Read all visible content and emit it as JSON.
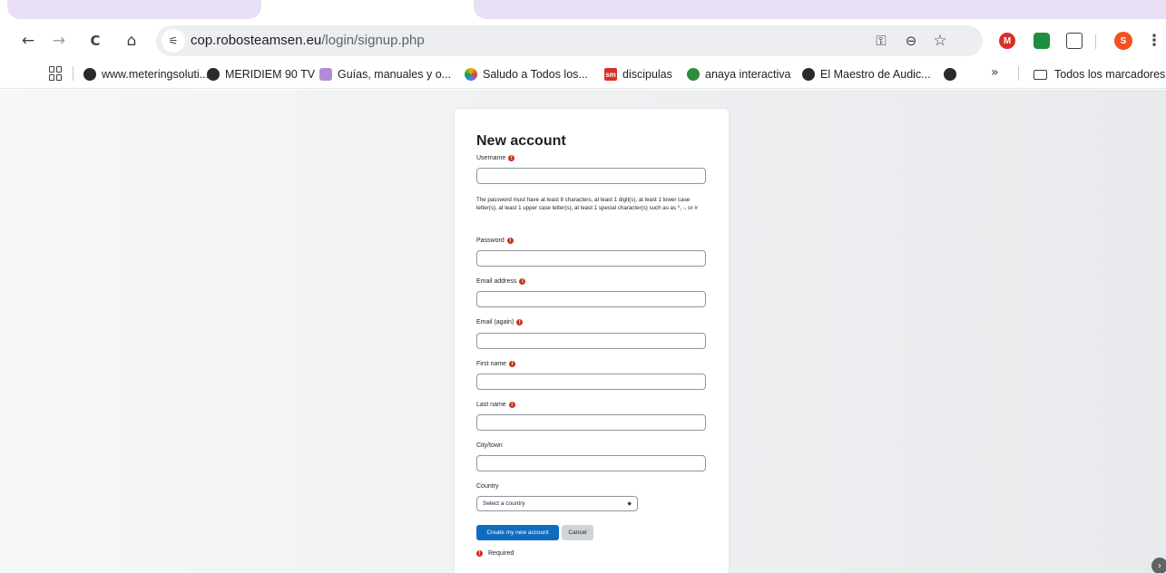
{
  "browser": {
    "url_host": "cop.robosteamsen.eu",
    "url_path": "/login/signup.php",
    "nav": {
      "back": "←",
      "forward": "→",
      "reload": "C",
      "home": "⌂",
      "site_info": "⚟"
    },
    "omnibox_icons": {
      "key": "⚿",
      "zoom": "⊖",
      "star": "☆"
    },
    "extensions": {
      "m_label": "M",
      "profile_initial": "S",
      "menu": "⋮"
    },
    "colors": {
      "tab_strip": "#e9dff6",
      "extension_red": "#d93025",
      "extension_green": "#1e8e3e",
      "profile_orange": "#f4511e"
    }
  },
  "bookmarks": {
    "items": [
      {
        "label": "www.meteringsoluti...",
        "icon": "globe-icon"
      },
      {
        "label": "MERIDIEM 90 TV",
        "icon": "globe-icon"
      },
      {
        "label": "Guías, manuales y o...",
        "icon": "sparkle-icon"
      },
      {
        "label": "Saludo a Todos los...",
        "icon": "colorful-ball-icon"
      },
      {
        "label": "discipulas",
        "icon": "sm-icon"
      },
      {
        "label": "anaya interactiva",
        "icon": "green-circle-icon"
      },
      {
        "label": "El Maestro de Audic...",
        "icon": "globe-icon"
      }
    ],
    "more": "»",
    "all_bookmarks": "Todos los marcadores",
    "sm_badge": "sm"
  },
  "form": {
    "title": "New account",
    "password_hint": "The password must have at least 8 characters, at least 1 digit(s), at least 1 lower case letter(s), at least 1 upper case letter(s), at least 1 special character(s) such as as *, -, or #",
    "fields": {
      "username": {
        "label": "Username",
        "value": ""
      },
      "password": {
        "label": "Password",
        "value": ""
      },
      "email": {
        "label": "Email address",
        "value": ""
      },
      "email_again": {
        "label": "Email (again)",
        "value": ""
      },
      "first_name": {
        "label": "First name",
        "value": ""
      },
      "last_name": {
        "label": "Last name",
        "value": ""
      },
      "city": {
        "label": "City/town",
        "value": ""
      },
      "country": {
        "label": "Country",
        "selected": "Select a country"
      }
    },
    "required_mark": "!",
    "submit_label": "Create my new account",
    "cancel_label": "Cancel",
    "required_note": "Required",
    "colors": {
      "primary": "#0f6cbf",
      "secondary": "#ced4da",
      "required": "#ca3120"
    }
  }
}
